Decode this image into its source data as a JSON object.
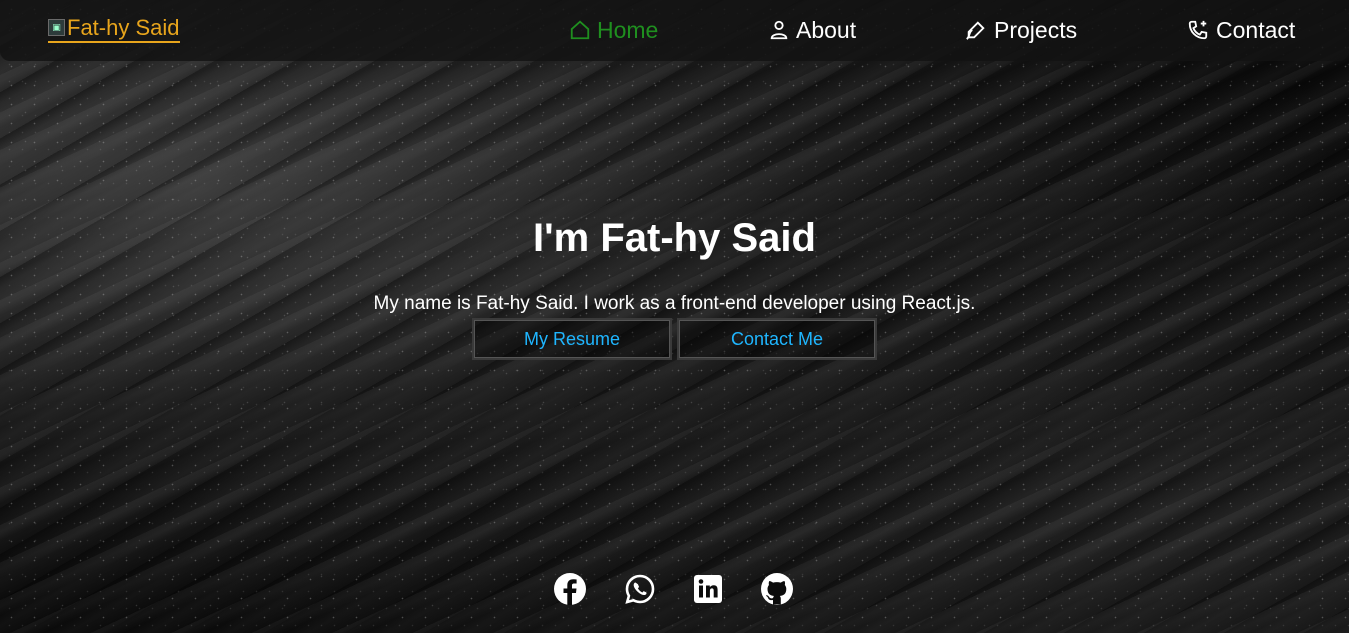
{
  "navbar": {
    "brand": "Fat-hy Said",
    "items": [
      {
        "label": "Home",
        "icon": "home-icon",
        "active": true
      },
      {
        "label": "About",
        "icon": "user-icon",
        "active": false
      },
      {
        "label": "Projects",
        "icon": "pen-icon",
        "active": false
      },
      {
        "label": "Contact",
        "icon": "phone-plus-icon",
        "active": false
      }
    ]
  },
  "hero": {
    "title": "I'm Fat-hy Said",
    "description": "My name is Fat-hy Said. I work as a front-end developer using React.js.",
    "buttons": {
      "resume": "My Resume",
      "contact": "Contact Me"
    }
  },
  "socials": [
    "facebook-icon",
    "whatsapp-icon",
    "linkedin-icon",
    "github-icon"
  ],
  "colors": {
    "brand": "#e8a51c",
    "active_nav": "#1f8f1f",
    "button_text": "#1fb6ff"
  }
}
